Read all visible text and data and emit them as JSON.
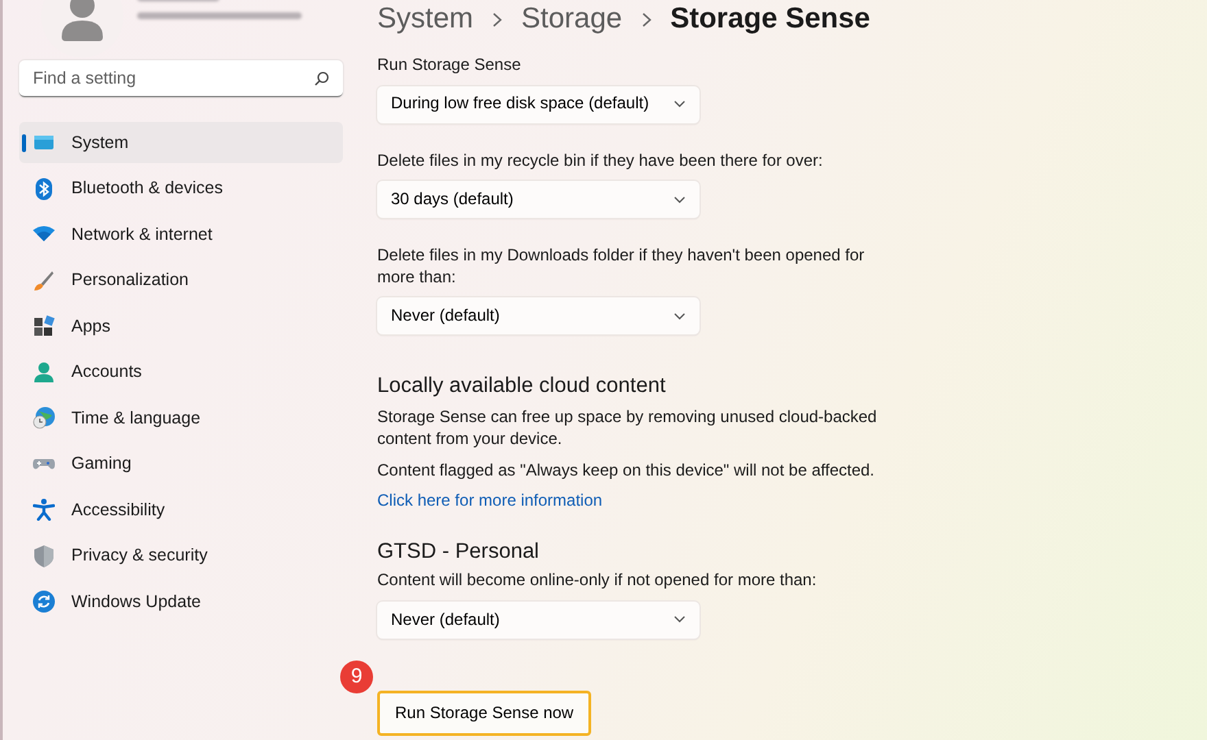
{
  "sidebar": {
    "search": {
      "placeholder": "Find a setting"
    },
    "items": [
      {
        "label": "System",
        "selected": true
      },
      {
        "label": "Bluetooth & devices",
        "selected": false
      },
      {
        "label": "Network & internet",
        "selected": false
      },
      {
        "label": "Personalization",
        "selected": false
      },
      {
        "label": "Apps",
        "selected": false
      },
      {
        "label": "Accounts",
        "selected": false
      },
      {
        "label": "Time & language",
        "selected": false
      },
      {
        "label": "Gaming",
        "selected": false
      },
      {
        "label": "Accessibility",
        "selected": false
      },
      {
        "label": "Privacy & security",
        "selected": false
      },
      {
        "label": "Windows Update",
        "selected": false
      }
    ]
  },
  "breadcrumb": [
    "System",
    "Storage",
    "Storage Sense"
  ],
  "sections": [
    {
      "kind": "dropdown",
      "label": "Run Storage Sense",
      "value": "During low free disk space (default)"
    },
    {
      "kind": "dropdown",
      "label": "Delete files in my recycle bin if they have been there for over:",
      "value": "30 days (default)"
    },
    {
      "kind": "dropdown",
      "label": "Delete files in my Downloads folder if they haven't been opened for more than:",
      "value": "Never (default)"
    },
    {
      "kind": "heading",
      "label": "Locally available cloud content"
    },
    {
      "kind": "text",
      "label": "Storage Sense can free up space by removing unused cloud-backed content from your device."
    },
    {
      "kind": "text",
      "label": "Content flagged as \"Always keep on this device\" will not be affected."
    },
    {
      "kind": "link",
      "label": "Click here for more information"
    },
    {
      "kind": "heading",
      "label": "GTSD - Personal"
    },
    {
      "kind": "dropdown",
      "label": "Content will become online-only if not opened for more than:",
      "value": "Never (default)"
    }
  ],
  "run_button": {
    "label": "Run Storage Sense now",
    "highlighted": true,
    "callout": "9"
  }
}
